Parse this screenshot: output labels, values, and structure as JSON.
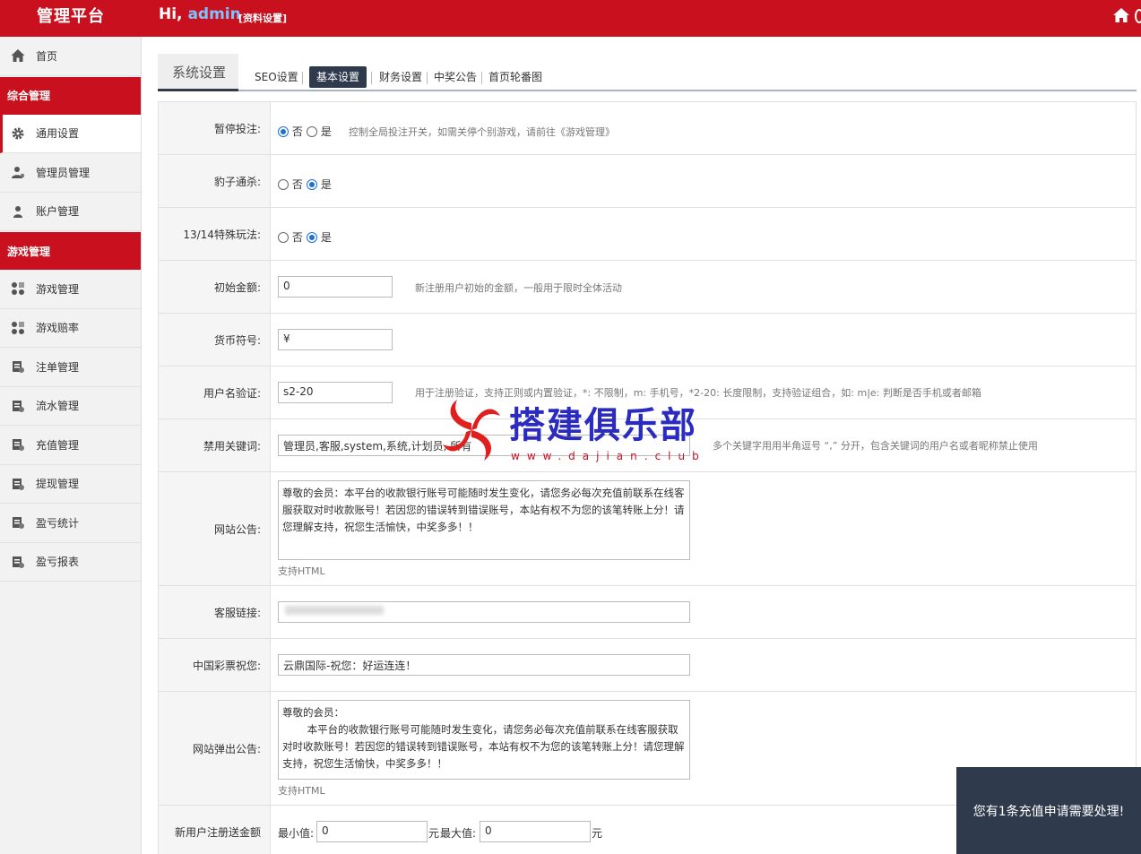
{
  "header": {
    "brand": "管理平台",
    "greeting": "Hi,",
    "username": "admin",
    "profile_link": "[资料设置]"
  },
  "sidebar": {
    "items": [
      {
        "label": "首页",
        "icon": "home-icon"
      },
      {
        "group": "综合管理"
      },
      {
        "label": "通用设置",
        "icon": "gear-icon"
      },
      {
        "label": "管理员管理",
        "icon": "admin-user-icon"
      },
      {
        "label": "账户管理",
        "icon": "user-icon"
      },
      {
        "group": "游戏管理"
      },
      {
        "label": "游戏管理",
        "icon": "game-icon"
      },
      {
        "label": "游戏赔率",
        "icon": "odds-icon"
      },
      {
        "label": "注单管理",
        "icon": "ledger-icon"
      },
      {
        "label": "流水管理",
        "icon": "ledger-icon"
      },
      {
        "label": "充值管理",
        "icon": "ledger-icon"
      },
      {
        "label": "提现管理",
        "icon": "ledger-icon"
      },
      {
        "label": "盈亏统计",
        "icon": "ledger-icon"
      },
      {
        "label": "盈亏报表",
        "icon": "ledger-icon"
      }
    ]
  },
  "tabs": {
    "main": "系统设置",
    "items": [
      "SEO设置",
      "基本设置",
      "财务设置",
      "中奖公告",
      "首页轮番图"
    ],
    "active": "基本设置"
  },
  "form": {
    "pause_bet": {
      "label": "暂停投注:",
      "no": "否",
      "yes": "是",
      "selected": "否",
      "hint": "控制全局投注开关，如需关停个别游戏，请前往《游戏管理》"
    },
    "leopard_kill": {
      "label": "豹子通杀:",
      "no": "否",
      "yes": "是",
      "selected": "是"
    },
    "special_1314": {
      "label": "13/14特殊玩法:",
      "no": "否",
      "yes": "是",
      "selected": "是"
    },
    "initial_amount": {
      "label": "初始金额:",
      "value": "0",
      "hint": "新注册用户初始的金额，一般用于限时全体活动"
    },
    "currency_symbol": {
      "label": "货币符号:",
      "value": "¥"
    },
    "username_validation": {
      "label": "用户名验证:",
      "value": "s2-20",
      "hint": "用于注册验证，支持正则或内置验证，*: 不限制，m: 手机号，*2-20: 长度限制，支持验证组合，如: m|e: 判断是否手机或者邮箱"
    },
    "banned_keywords": {
      "label": "禁用关键词:",
      "value": "管理员,客服,system,系统,计划员, 所有",
      "hint": "多个关键字用用半角逗号 “,” 分开，包含关键词的用户名或者昵称禁止使用"
    },
    "site_notice": {
      "label": "网站公告:",
      "value": "尊敬的会员：本平台的收款银行账号可能随时发生变化，请您务必每次充值前联系在线客服获取对时收款账号！若因您的错误转到错误账号，本站有权不为您的该笔转账上分！请您理解支持，祝您生活愉快，中奖多多！！",
      "note": "支持HTML"
    },
    "service_link": {
      "label": "客服链接:",
      "value": ""
    },
    "lottery_wish": {
      "label": "中国彩票祝您:",
      "value": "云鼎国际-祝您：好运连连！"
    },
    "popup_notice": {
      "label": "网站弹出公告:",
      "line1": "尊敬的会员：",
      "line2": "本平台的收款银行账号可能随时发生变化，请您务必每次充值前联系在线客服获取对时收款账号！若因您的错误转到错误账号，本站有权不为您的该笔转账上分！请您理解支持，祝您生活愉快，中奖多多！！",
      "note": "支持HTML"
    },
    "new_user_bonus": {
      "label": "新用户注册送金额",
      "min_label": "最小值:",
      "min_value": "0",
      "unit": "元",
      "max_label": "最大值:",
      "max_value": "0"
    }
  },
  "watermark": {
    "text": "搭建俱乐部",
    "url": "www.dajian.club"
  },
  "toast": {
    "message": "您有1条充值申请需要处理!"
  },
  "colors": {
    "brand_red": "#c8101e",
    "navy": "#2f3a4d",
    "radio_blue": "#1d6fd6"
  }
}
